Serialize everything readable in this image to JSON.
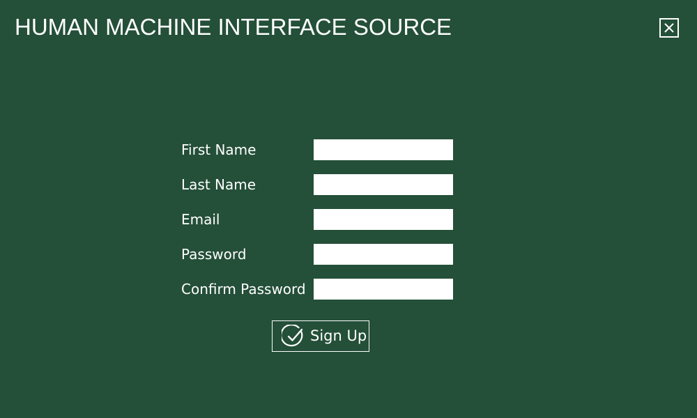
{
  "window": {
    "title": "HUMAN MACHINE INTERFACE SOURCE",
    "close_icon": "close-box-icon"
  },
  "form": {
    "fields": [
      {
        "label": "First Name",
        "value": "",
        "placeholder": ""
      },
      {
        "label": "Last Name",
        "value": "",
        "placeholder": ""
      },
      {
        "label": "Email",
        "value": "",
        "placeholder": ""
      },
      {
        "label": "Password",
        "value": "",
        "placeholder": ""
      },
      {
        "label": "Confirm Password",
        "value": "",
        "placeholder": ""
      }
    ],
    "submit": {
      "label": "Sign Up",
      "icon": "check-circle-icon"
    }
  },
  "colors": {
    "background": "#244F38",
    "text": "#FFFFFF",
    "input_background": "#FFFFFF"
  }
}
